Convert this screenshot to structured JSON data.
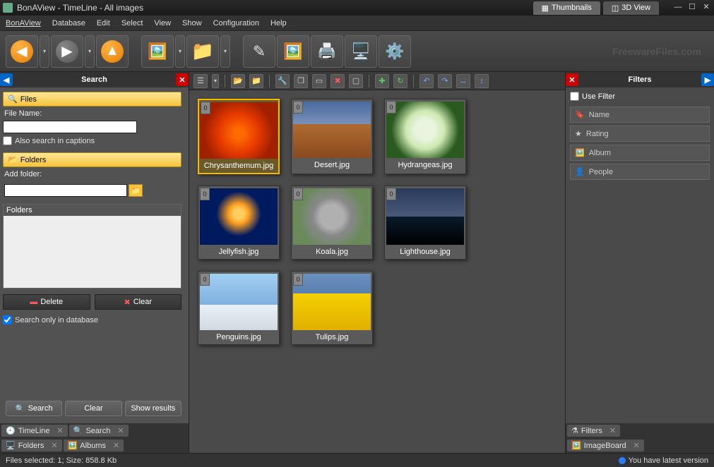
{
  "title": "BonAView - TimeLine - All images",
  "view_tabs": {
    "thumbnails": "Thumbnails",
    "view3d": "3D View"
  },
  "menu": {
    "bonaview": "BonAView",
    "database": "Database",
    "edit": "Edit",
    "select": "Select",
    "view": "View",
    "show": "Show",
    "configuration": "Configuration",
    "help": "Help"
  },
  "watermark": "FreewareFiles.com",
  "left": {
    "header": "Search",
    "files_section": "Files",
    "file_name_label": "File Name:",
    "file_name_value": "",
    "also_captions": "Also search in captions",
    "folders_section": "Folders",
    "add_folder_label": "Add folder:",
    "add_folder_value": "",
    "folders_box_head": "Folders",
    "delete_btn": "Delete",
    "clear_btn": "Clear",
    "search_only_db": "Search only in database",
    "search_btn": "Search",
    "clear2_btn": "Clear",
    "show_results_btn": "Show results",
    "tabs": {
      "timeline": "TimeLine",
      "search": "Search",
      "folders": "Folders",
      "albums": "Albums"
    }
  },
  "thumbs": [
    {
      "name": "Chrysanthemum.jpg",
      "cls": "img-chrys",
      "selected": true
    },
    {
      "name": "Desert.jpg",
      "cls": "img-desert",
      "selected": false
    },
    {
      "name": "Hydrangeas.jpg",
      "cls": "img-hydra",
      "selected": false
    },
    {
      "name": "Jellyfish.jpg",
      "cls": "img-jelly",
      "selected": false
    },
    {
      "name": "Koala.jpg",
      "cls": "img-koala",
      "selected": false
    },
    {
      "name": "Lighthouse.jpg",
      "cls": "img-light",
      "selected": false
    },
    {
      "name": "Penguins.jpg",
      "cls": "img-peng",
      "selected": false
    },
    {
      "name": "Tulips.jpg",
      "cls": "img-tulip",
      "selected": false
    }
  ],
  "right": {
    "header": "Filters",
    "use_filter": "Use Filter",
    "items": {
      "name": "Name",
      "rating": "Rating",
      "album": "Album",
      "people": "People"
    },
    "tabs": {
      "filters": "Filters",
      "imageboard": "ImageBoard"
    }
  },
  "status": {
    "left": "Files selected: 1; Size: 858.8 Kb",
    "right": "You have latest version"
  }
}
